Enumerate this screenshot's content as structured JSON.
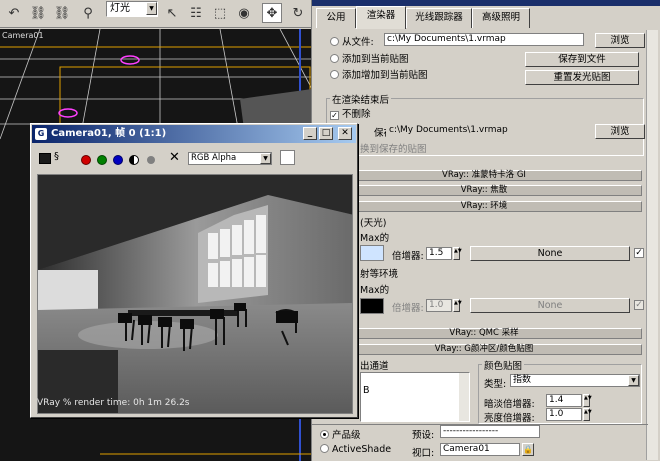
{
  "toolbar": {
    "selection_filter": "灯光"
  },
  "viewport": {
    "label": "Camera01"
  },
  "render_panel": {
    "tabs": [
      {
        "label": "公用"
      },
      {
        "label": "渲染器"
      },
      {
        "label": "光线跟踪器"
      },
      {
        "label": "高级照明"
      }
    ],
    "from_file_label": "从文件:",
    "file_path": "c:\\My Documents\\1.vrmap",
    "browse_label": "浏览",
    "add_to_current": "添加到当前贴图",
    "add_incremental": "添加增加到当前贴图",
    "save_to_file": "保存到文件",
    "reset_map": "重置发光贴图",
    "after_render_title": "在渲染结束后",
    "no_delete": "不删除",
    "autosave_label": "保存:",
    "autosave_path": "c:\\My Documents\\1.vrmap",
    "browse2_label": "浏览",
    "switch_saved": "换到保存的贴图",
    "rollouts": [
      "VRay:: 准蒙特卡洛 GI",
      "VRay:: 焦散",
      "VRay:: 环境"
    ],
    "skylight_title": "(天光)",
    "max_label_1": "Max的",
    "multiplier_label": "倍增器:",
    "multiplier_value": "1.5",
    "none_label": "None",
    "reflect_env": "射等环境",
    "max_label_2": "Max的",
    "multiplier2_value": "1.0",
    "none2_label": "None",
    "rollout_qmc": "VRay:: QMC 采样",
    "rollout_cm": "VRay:: G颜冲区/颜色贴图",
    "output_channel": "出通道",
    "channel_b": "B",
    "color_map_title": "颜色贴图",
    "type_label": "类型:",
    "type_value": "指数",
    "dark_mult_label": "暗淡倍增器:",
    "dark_mult_value": "1.4",
    "bright_mult_label": "亮度倍增器:",
    "bright_mult_value": "1.0",
    "production": "产品级",
    "activeshade": "ActiveShade",
    "preset_label": "预设:",
    "preset_value": "-----------------",
    "view_label": "视口:",
    "view_value": "Camera01"
  },
  "frame_buffer": {
    "title": "Camera01, 帧 0 (1:1)",
    "channel_select": "RGB Alpha",
    "status": "VRay % render time: 0h 1m 26.2s"
  },
  "colors": {
    "title_blue": "#0a246a",
    "red_dot": "#d00000",
    "green_dot": "#008000",
    "blue_dot": "#0000c0"
  }
}
